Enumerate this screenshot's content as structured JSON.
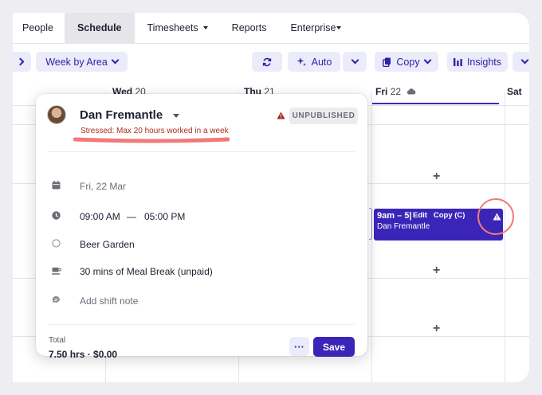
{
  "nav": {
    "items": [
      {
        "label": "People",
        "active": false
      },
      {
        "label": "Schedule",
        "active": true
      },
      {
        "label": "Timesheets",
        "active": false
      },
      {
        "label": "Reports",
        "active": false
      },
      {
        "label": "Enterprise",
        "active": false
      }
    ]
  },
  "toolbar": {
    "view_label": "Week by Area",
    "auto_label": "Auto",
    "copy_label": "Copy",
    "insights_label": "Insights"
  },
  "calendar": {
    "days": [
      {
        "name": "Wed",
        "num": "20"
      },
      {
        "name": "Thu",
        "num": "21"
      },
      {
        "name": "Fri",
        "num": "22"
      },
      {
        "name": "Sat",
        "num": ""
      }
    ],
    "shift": {
      "time": "9am – 5|",
      "edit_label": "Edit",
      "copy_label": "Copy (C)",
      "employee": "Dan Fremantle"
    }
  },
  "popup": {
    "employee_name": "Dan Fremantle",
    "status_badge": "UNPUBLISHED",
    "warning": "Stressed: Max 20 hours worked in a week",
    "date": "Fri, 22 Mar",
    "start_time": "09:00 AM",
    "time_separator": "—",
    "end_time": "05:00 PM",
    "area": "Beer Garden",
    "meal_break": "30 mins of Meal Break (unpaid)",
    "note_placeholder": "Add shift note",
    "total_label": "Total",
    "total_value": "7.50 hrs · $0.00",
    "more_label": "···",
    "save_label": "Save"
  },
  "colors": {
    "accent": "#3b25b8",
    "accent_light": "#ecebfa",
    "warning_red": "#b02a1e",
    "highlight": "#f07a7a"
  }
}
